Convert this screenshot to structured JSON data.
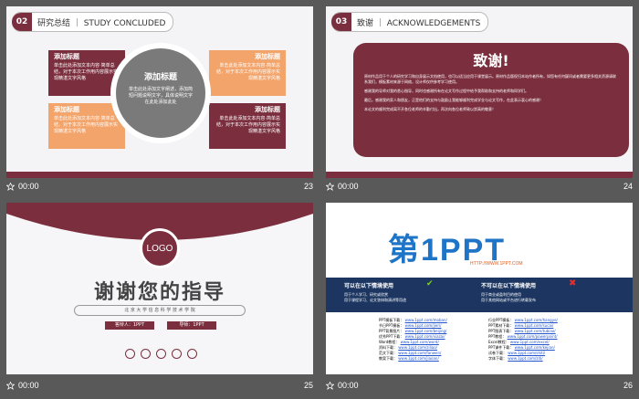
{
  "slides": [
    {
      "number": "23",
      "time": "00:00",
      "section_num": "02",
      "section_title": "研究总结 ｜ STUDY CONCLUDED",
      "center_title": "添加标题",
      "center_text": "单击此处添加文字阐述，添加简短问题说明文字，具体说明文字在此处添加此处",
      "boxes": [
        {
          "title": "添加标题",
          "text": "单击此处添加文本内容·简单总结，对于本次工作用内容展示实现精湛文字风格"
        },
        {
          "title": "添加标题",
          "text": "单击此处添加文本内容·简单总结，对于本次工作用内容展示实现精湛文字风格"
        },
        {
          "title": "添加标题",
          "text": "单击此处添加文本内容·简单总结，对于本次工作用内容展示实现精湛文字风格"
        },
        {
          "title": "添加标题",
          "text": "单击此处添加文本内容·简单总结，对于本次工作用内容展示实现精湛文字风格"
        }
      ]
    },
    {
      "number": "24",
      "time": "00:00",
      "section_num": "03",
      "section_title": "致谢 ｜ ACKNOWLEDGEMENTS",
      "heading": "致谢!",
      "para1": "原材作品用于个人的研究学习和自身展示文档使用，也可以适当应用于课堂展示。原材作品版权归本站作者所有，如您有任何疑问或者需要更多相关资源请联系我们，模板素材来源于网络，设计师仅供参考学习使用。",
      "para2": "感谢我的导师对我的悉心指导，同时也感谢所有在论文写作过程中给予我帮助和支持的老师和同学们。",
      "para3": "最后，感谢我的家人和朋友，正是他们的支持与鼓励让我能够顺利完成学业与论文写作，在此表示衷心的感谢！",
      "para4": "本论文的顺利完成离不开各位老师的辛勤付出，再次向各位老师致以崇高的敬意！"
    },
    {
      "number": "25",
      "time": "00:00",
      "logo": "LOGO",
      "title": "谢谢您的指导",
      "subtitle": "北 京 大 学 信 息 科 学 技 术 学 院",
      "presenter": "答辩人：1PPT",
      "advisor": "导师：1PPT"
    },
    {
      "number": "26",
      "time": "00:00",
      "brand": "第1PPT",
      "brand_url": "HTTP://WWW.1PPT.COM",
      "can_title": "可以在以下情境使用",
      "can_items": [
        "用于个人学习、研究或欣赏",
        "用于课程学习、论文答辩和演讲等用途"
      ],
      "cannot_title": "不可以在以下情境使用",
      "cannot_items": [
        "用于商业或盈利目的使用",
        "用于其他网站或平台进行转载发布"
      ],
      "links_left": [
        [
          "PPT模板下载：",
          "www.1ppt.com/moban/"
        ],
        [
          "节日PPT模板：",
          "www.1ppt.com/jieri/"
        ],
        [
          "PPT背景图片：",
          "www.1ppt.com/beijing/"
        ],
        [
          "优秀PPT下载：",
          "www.1ppt.com/xiazai/"
        ],
        [
          "Word教程：",
          "www.1ppt.com/word/"
        ],
        [
          "资料下载：",
          "www.1ppt.com/ziliao/"
        ],
        [
          "范文下载：",
          "www.1ppt.com/fanwen/"
        ],
        [
          "教案下载：",
          "www.1ppt.com/jiaoan/"
        ]
      ],
      "links_right": [
        [
          "行业PPT模板：",
          "www.1ppt.com/hangye/"
        ],
        [
          "PPT素材下载：",
          "www.1ppt.com/sucai/"
        ],
        [
          "PPT图表下载：",
          "www.1ppt.com/tubiao/"
        ],
        [
          "PPT教程：",
          "www.1ppt.com/powerpoint/"
        ],
        [
          "Excel教程：",
          "www.1ppt.com/excel/"
        ],
        [
          "PPT课件下载：",
          "www.1ppt.com/kejian/"
        ],
        [
          "试卷下载：",
          "www.1ppt.com/shiti/"
        ],
        [
          "字体下载：",
          "www.1ppt.com/ziti/"
        ]
      ]
    }
  ],
  "colors": {
    "accent": "#7b2f3e",
    "orange": "#f2a46b",
    "gray": "#7a7a7a",
    "navy": "#1c3661"
  }
}
